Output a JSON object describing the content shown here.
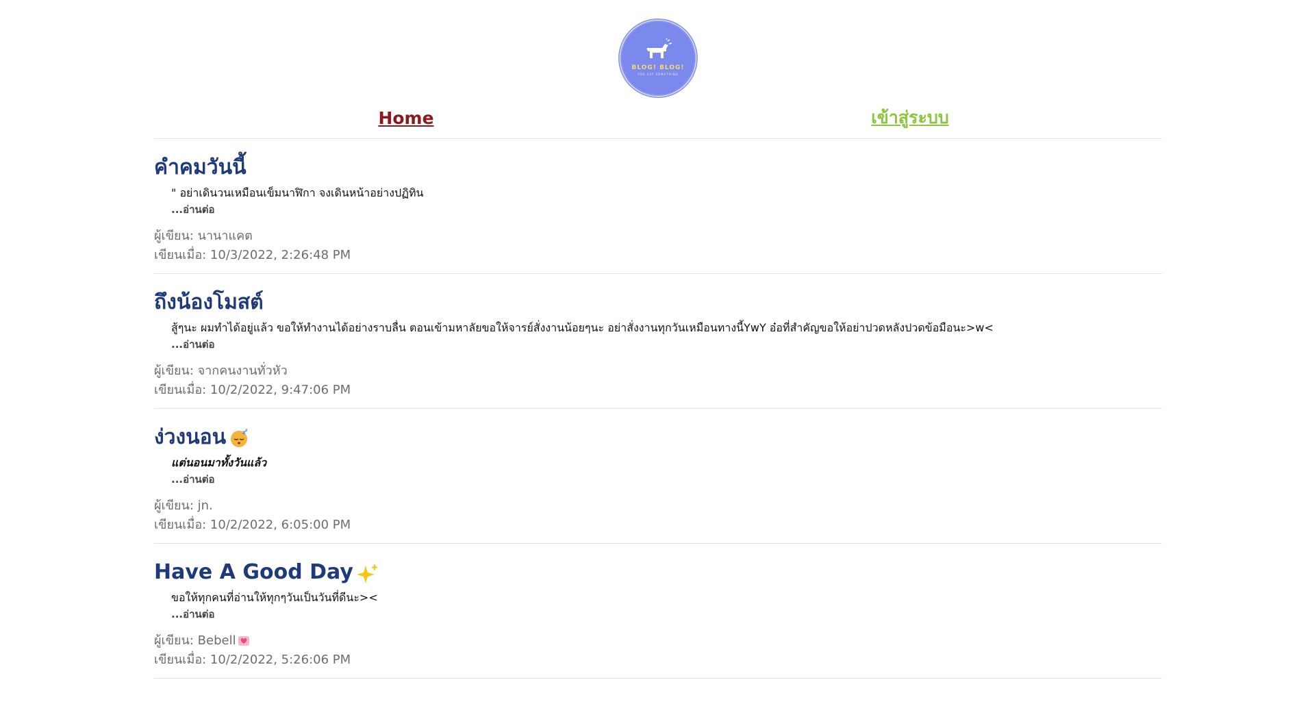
{
  "logo": {
    "text": "BLOG! BLOG!",
    "subtext": "YOU SAY SOMETHING"
  },
  "nav": {
    "home": "Home",
    "login": "เข้าสู่ระบบ"
  },
  "posts": [
    {
      "title": "คำคมวันนี้",
      "excerpt": "\" อย่าเดินวนเหมือนเข็มนาฬิกา จงเดินหน้าอย่างปฏิทิน",
      "readmore": "...อ่านต่อ",
      "author": "ผู้เขียน: นานาแคต",
      "date": "เขียนเมื่อ: 10/3/2022, 2:26:48 PM"
    },
    {
      "title": "ถึงน้องโมสต์",
      "excerpt": "สู้ๆนะ ผมทำได้อยู่แล้ว ขอให้ทำงานได้อย่างราบลื่น ตอนเข้ามหาลัยขอให้จารย์สั่งงานน้อยๆนะ อย่าสั่งงานทุกวันเหมือนทางนี้YwY อ๋อที่สำคัญขอให้อย่าปวดหลังปวดข้อมือนะ>w<",
      "readmore": "...อ่านต่อ",
      "author": "ผู้เขียน: จากคนงานทั่วหัว",
      "date": "เขียนเมื่อ: 10/2/2022, 9:47:06 PM"
    },
    {
      "title": "ง่วงนอน",
      "excerpt": "แต่นอนมาทั้งวันแล้ว",
      "readmore": "...อ่านต่อ",
      "author": "ผู้เขียน: jn.",
      "date": "เขียนเมื่อ: 10/2/2022, 6:05:00 PM"
    },
    {
      "title": "Have A Good Day",
      "excerpt": "ขอให้ทุกคนที่อ่านให้ทุกๆวันเป็นวันที่ดีนะ><",
      "readmore": "...อ่านต่อ",
      "author": "ผู้เขียน: Bebell",
      "date": "เขียนเมื่อ: 10/2/2022, 5:26:06 PM"
    }
  ]
}
